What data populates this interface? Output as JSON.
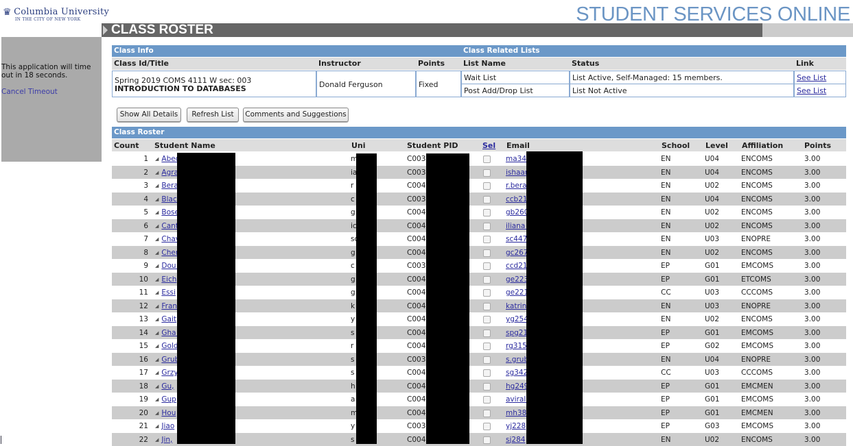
{
  "header": {
    "logo_name": "Columbia University",
    "logo_sub": "IN THE CITY OF NEW YORK",
    "site_title": "STUDENT SERVICES ONLINE",
    "page_title": "CLASS ROSTER"
  },
  "sidebar": {
    "timeout_text": "This application will time out in 18 seconds.",
    "cancel_label": "Cancel Timeout"
  },
  "class_info": {
    "section_label": "Class Info",
    "related_label": "Class Related Lists",
    "col_id": "Class Id/Title",
    "col_instructor": "Instructor",
    "col_points": "Points",
    "col_listname": "List Name",
    "col_status": "Status",
    "col_link": "Link",
    "class_id": "Spring 2019 COMS 4111 W sec: 003",
    "class_title": "INTRODUCTION TO DATABASES",
    "instructor": "Donald Ferguson",
    "points": "Fixed",
    "lists": [
      {
        "name": "Wait List",
        "status": "List Active, Self-Managed: 15 members.",
        "link": "See List"
      },
      {
        "name": "Post Add/Drop List",
        "status": "List Not Active",
        "link": "See List"
      }
    ]
  },
  "buttons": {
    "show_all": "Show All Details",
    "refresh": "Refresh List",
    "comments": "Comments and Suggestions"
  },
  "roster": {
    "section_label": "Class Roster",
    "columns": {
      "count": "Count",
      "name": "Student Name",
      "uni": "Uni",
      "pid": "Student PID",
      "sel": "Sel",
      "email": "Email",
      "school": "School",
      "level": "Level",
      "affiliation": "Affiliation",
      "points": "Points"
    },
    "rows": [
      {
        "count": "1",
        "name": "Abed                                    ed",
        "uni": "m       5",
        "pid": "C0039",
        "email": "ma34                                  u",
        "school": "EN",
        "level": "U04",
        "affiliation": "ENCOMS",
        "points": "3.00"
      },
      {
        "count": "2",
        "name": "Agra                                    ore",
        "uni": "ia",
        "pid": "C0039",
        "email": "ishaar                                  bia.edu",
        "school": "EN",
        "level": "U04",
        "affiliation": "ENCOMS",
        "points": "3.00"
      },
      {
        "count": "3",
        "name": "Bera",
        "uni": "r          3",
        "pid": "C0041",
        "email": "r.bera",
        "school": "EN",
        "level": "U02",
        "affiliation": "ENCOMS",
        "points": "3.00"
      },
      {
        "count": "4",
        "name": "Blac                                    les Christopher",
        "uni": "c          3",
        "pid": "C0039",
        "email": "ccb21                                  u",
        "school": "EN",
        "level": "U04",
        "affiliation": "ENCOMS",
        "points": "3.00"
      },
      {
        "count": "5",
        "name": "Bose",
        "uni": "g",
        "pid": "C0041",
        "email": "gb260",
        "school": "EN",
        "level": "U02",
        "affiliation": "ENCOMS",
        "points": "3.00"
      },
      {
        "count": "6",
        "name": "Cant",
        "uni": "ic",
        "pid": "C0041",
        "email": "iliana                                  .edu",
        "school": "EN",
        "level": "U02",
        "affiliation": "ENCOMS",
        "points": "3.00"
      },
      {
        "count": "7",
        "name": "Chav",
        "uni": "sc",
        "pid": "C0042",
        "email": "sc447",
        "school": "EN",
        "level": "U03",
        "affiliation": "ENOPRE",
        "points": "3.00"
      },
      {
        "count": "8",
        "name": "Cher",
        "uni": "g",
        "pid": "C0040",
        "email": "gc267",
        "school": "EN",
        "level": "U02",
        "affiliation": "ENCOMS",
        "points": "3.00"
      },
      {
        "count": "9",
        "name": "Dou                                    ameron",
        "uni": "c          4",
        "pid": "C0038",
        "email": "ccd21                                  u",
        "school": "EP",
        "level": "G01",
        "affiliation": "EMCOMS",
        "points": "3.00"
      },
      {
        "count": "10",
        "name": "Eich",
        "uni": "g",
        "pid": "C0042",
        "email": "ge223",
        "school": "EP",
        "level": "G01",
        "affiliation": "ETCOMS",
        "points": "3.00"
      },
      {
        "count": "11",
        "name": "Essi",
        "uni": "g",
        "pid": "C0040",
        "email": "ge221",
        "school": "CC",
        "level": "U03",
        "affiliation": "CCCOMS",
        "points": "3.00"
      },
      {
        "count": "12",
        "name": "Fran",
        "uni": "k",
        "pid": "C0040",
        "email": "katrin                                  bia.edu",
        "school": "EN",
        "level": "U03",
        "affiliation": "ENOPRE",
        "points": "3.00"
      },
      {
        "count": "13",
        "name": "Gait",
        "uni": "y",
        "pid": "C0042",
        "email": "yg254",
        "school": "EN",
        "level": "U02",
        "affiliation": "ENCOMS",
        "points": "3.00"
      },
      {
        "count": "14",
        "name": "Gha                                    ep",
        "uni": "s          4",
        "pid": "C0042",
        "email": "spg21                                  u",
        "school": "EP",
        "level": "G01",
        "affiliation": "EMCOMS",
        "points": "3.00"
      },
      {
        "count": "15",
        "name": "Gold",
        "uni": "r",
        "pid": "C0041",
        "email": "rg315",
        "school": "EP",
        "level": "G02",
        "affiliation": "EMCOMS",
        "points": "3.00"
      },
      {
        "count": "16",
        "name": "Grub",
        "uni": "s",
        "pid": "C0039",
        "email": "s.grub                                  du",
        "school": "EN",
        "level": "U04",
        "affiliation": "ENOPRE",
        "points": "3.00"
      },
      {
        "count": "17",
        "name": "Grzy",
        "uni": "s",
        "pid": "C0040",
        "email": "sg342",
        "school": "CC",
        "level": "U03",
        "affiliation": "CCCOMS",
        "points": "3.00"
      },
      {
        "count": "18",
        "name": "Gu,",
        "uni": "h",
        "pid": "C0042",
        "email": "hg249",
        "school": "EP",
        "level": "G01",
        "affiliation": "EMCMEN",
        "points": "3.00"
      },
      {
        "count": "19",
        "name": "Gup",
        "uni": "a",
        "pid": "C0042",
        "email": "aviral                                  .edu",
        "school": "EP",
        "level": "G01",
        "affiliation": "EMCOMS",
        "points": "3.00"
      },
      {
        "count": "20",
        "name": "Hou",
        "uni": "m       5",
        "pid": "C0042",
        "email": "mh38                                  u",
        "school": "EP",
        "level": "G01",
        "affiliation": "EMCMEN",
        "points": "3.00"
      },
      {
        "count": "21",
        "name": "Jiao",
        "uni": "y",
        "pid": "C0037",
        "email": "yj228",
        "school": "EP",
        "level": "G03",
        "affiliation": "EMCOMS",
        "points": "3.00"
      },
      {
        "count": "22",
        "name": "Jin,",
        "uni": "s",
        "pid": "C0041",
        "email": "sj284",
        "school": "EN",
        "level": "U02",
        "affiliation": "ENCOMS",
        "points": "3.00"
      }
    ]
  }
}
